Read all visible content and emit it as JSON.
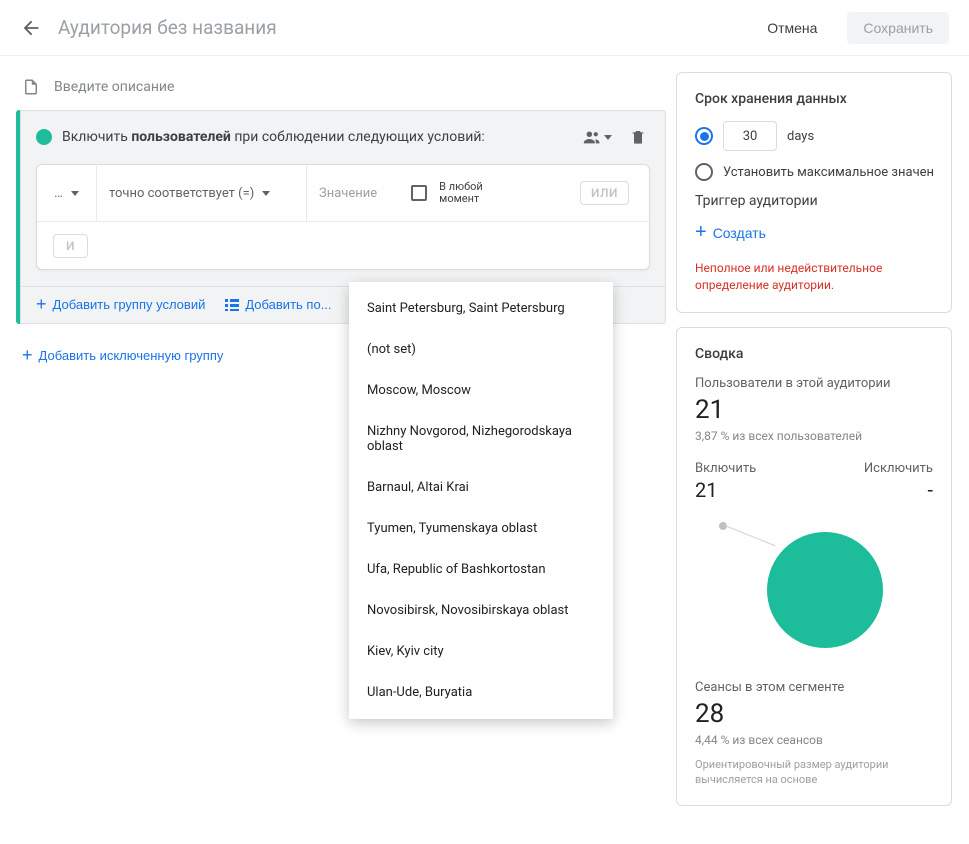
{
  "header": {
    "title": "Аудитория без названия",
    "cancel": "Отмена",
    "save": "Сохранить"
  },
  "description_placeholder": "Введите описание",
  "group": {
    "include_prefix": "Включить ",
    "include_bold": "пользователей",
    "include_suffix": " при соблюдении следующих условий:"
  },
  "rule": {
    "dimension": "…",
    "operator": "точно соответствует (=)",
    "value_placeholder": "Значение",
    "anytime": "В любой момент",
    "or": "ИЛИ",
    "and": "И"
  },
  "group_footer": {
    "add_group": "Добавить группу условий",
    "add_sequence": "Добавить по..."
  },
  "add_excluded": "Добавить исключенную группу",
  "dropdown": [
    "Saint Petersburg, Saint Petersburg",
    "(not set)",
    "Moscow, Moscow",
    "Nizhny Novgorod, Nizhegorodskaya oblast",
    "Barnaul, Altai Krai",
    "Tyumen, Tyumenskaya oblast",
    "Ufa, Republic of Bashkortostan",
    "Novosibirsk, Novosibirskaya oblast",
    "Kiev, Kyiv city",
    "Ulan-Ude, Buryatia"
  ],
  "retention": {
    "title": "Срок хранения данных",
    "days_value": "30",
    "days_label": "days",
    "max_label": "Установить максимальное значение"
  },
  "trigger": {
    "title": "Триггер аудитории",
    "create": "Создать"
  },
  "error_text": "Неполное или недействительное определение аудитории.",
  "summary": {
    "title": "Сводка",
    "users_label": "Пользователи в этой аудитории",
    "users_value": "21",
    "users_pct": "3,87 % из всех пользователей",
    "include_label": "Включить",
    "include_value": "21",
    "exclude_label": "Исключить",
    "exclude_value": "-",
    "sessions_label": "Сеансы в этом сегменте",
    "sessions_value": "28",
    "sessions_pct": "4,44 % из всех сеансов",
    "footnote": "Ориентировочный размер аудитории вычисляется на основе"
  }
}
